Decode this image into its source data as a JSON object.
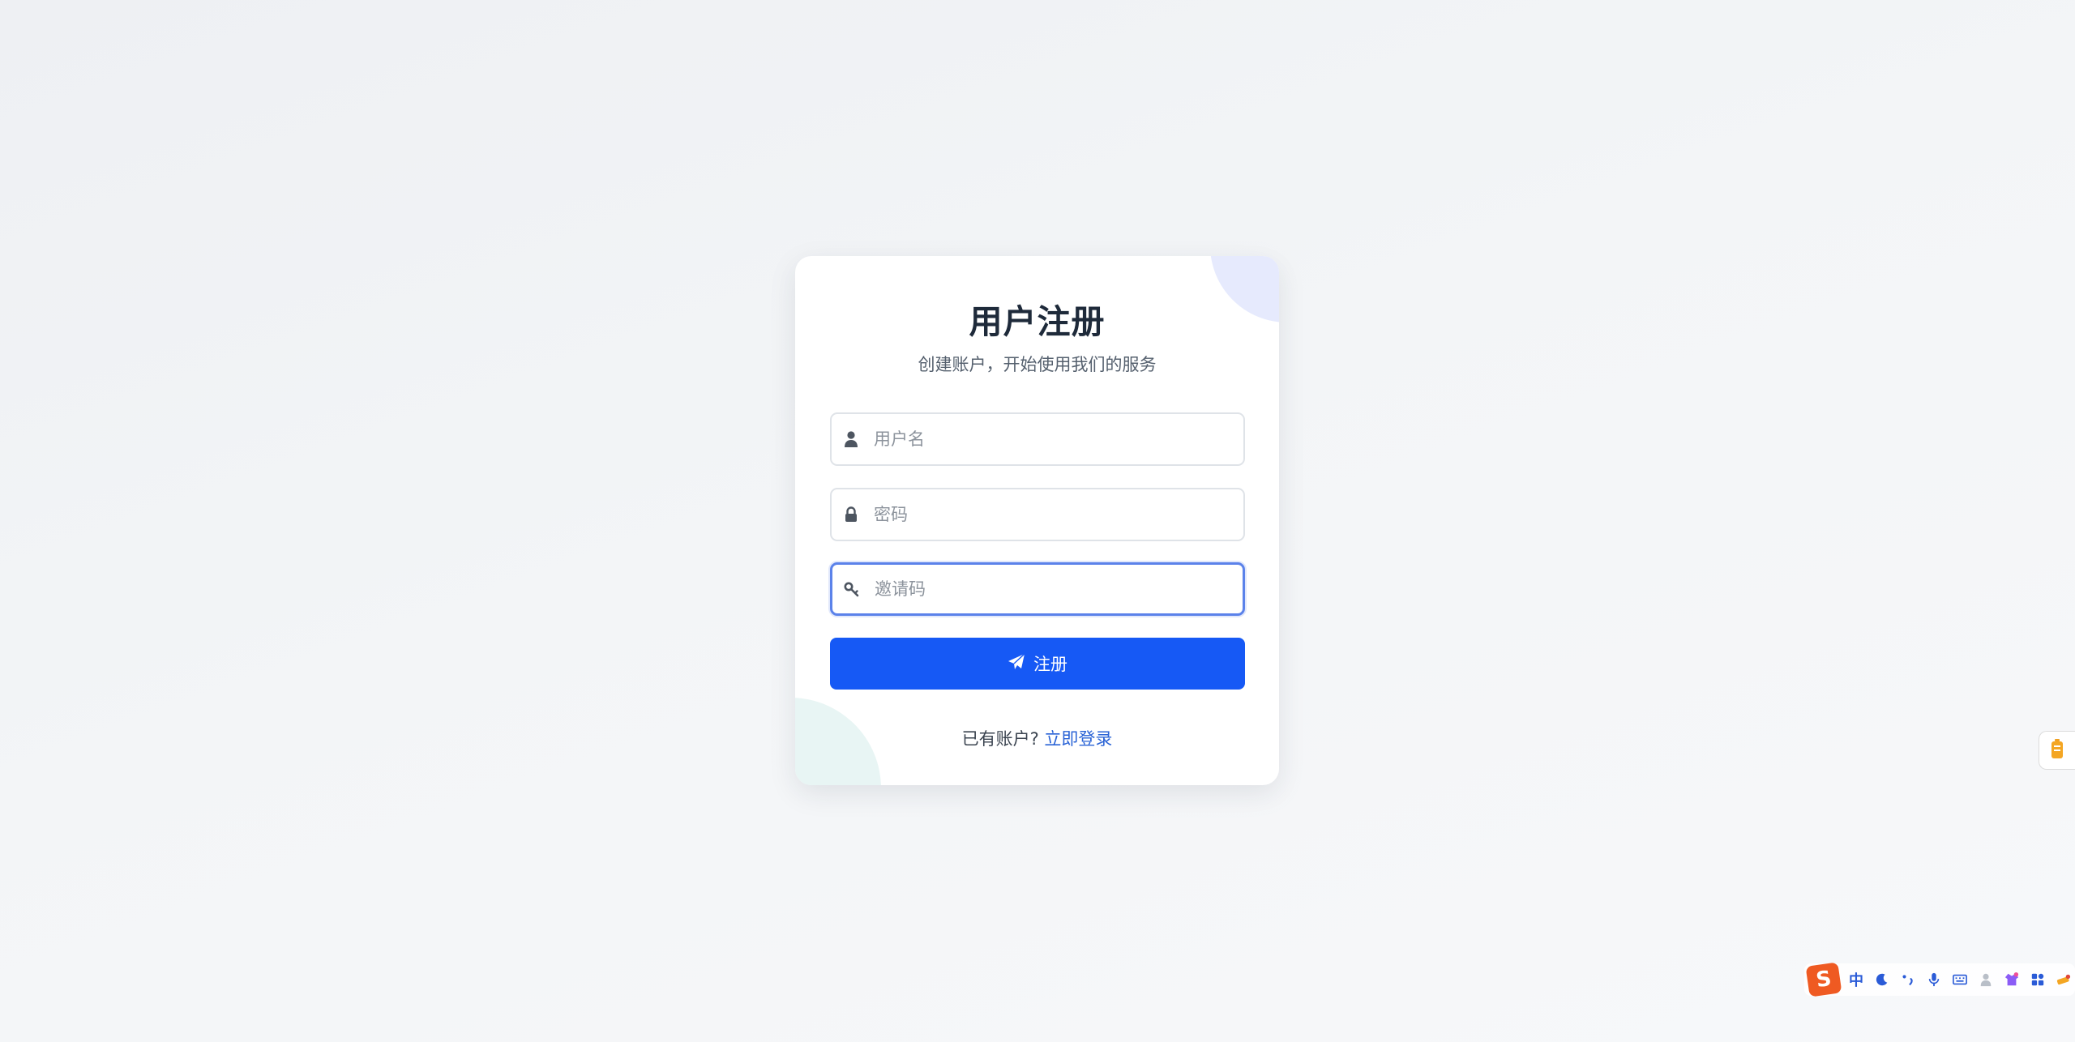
{
  "form": {
    "title": "用户注册",
    "subtitle": "创建账户，开始使用我们的服务",
    "username_placeholder": "用户名",
    "password_placeholder": "密码",
    "invite_placeholder": "邀请码",
    "submit_label": "注册",
    "footer_text": "已有账户? ",
    "login_link": "立即登录"
  },
  "colors": {
    "primary": "#1659f5",
    "link": "#2a63d6",
    "focus_border": "#5b82ea",
    "title": "#1e2a3a"
  },
  "ime_toolbar": {
    "logo": "S",
    "mode_label": "中",
    "items": [
      "moon-icon",
      "punctuation-icon",
      "microphone-icon",
      "keyboard-icon",
      "user-icon",
      "skin-icon",
      "apps-grid-icon",
      "tools-icon"
    ]
  }
}
